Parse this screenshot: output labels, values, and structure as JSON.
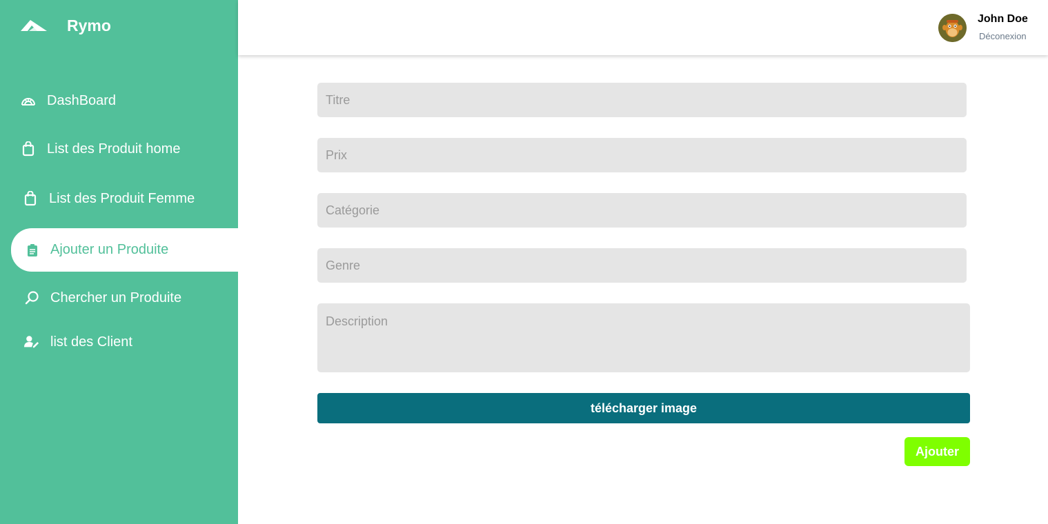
{
  "brand": {
    "name": "Rymo",
    "logo_icon": "plane-icon"
  },
  "sidebar": {
    "items": [
      {
        "label": "DashBoard",
        "icon": "dashboard-gauge-icon",
        "active": false
      },
      {
        "label": "List des Produit home",
        "icon": "shopping-bag-icon",
        "active": false
      },
      {
        "label": "List des Produit Femme",
        "icon": "shopping-bag-icon",
        "active": false
      },
      {
        "label": "Ajouter un Produite",
        "icon": "clipboard-list-icon",
        "active": true
      },
      {
        "label": "Chercher un Produite",
        "icon": "search-icon",
        "active": false
      },
      {
        "label": "list des Client",
        "icon": "user-edit-icon",
        "active": false
      }
    ]
  },
  "header": {
    "user_name": "John Doe",
    "logout_label": "Déconexion",
    "avatar": "avatar"
  },
  "form": {
    "titre_placeholder": "Titre",
    "prix_placeholder": "Prix",
    "categorie_placeholder": "Catégorie",
    "genre_placeholder": "Genre",
    "description_placeholder": "Description",
    "upload_label": "télécharger image",
    "submit_label": "Ajouter"
  },
  "colors": {
    "sidebar": "#52c09a",
    "upload_button": "#0a6e7d",
    "submit_button": "#7fff00",
    "field_background": "#e5e5e5"
  }
}
